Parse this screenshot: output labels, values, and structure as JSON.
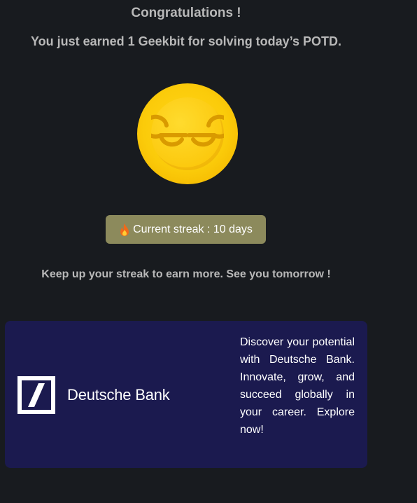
{
  "reward": {
    "title": "Congratulations !",
    "message": "You just earned 1 Geekbit for solving today’s POTD.",
    "coin_icon": "geekbit-coin-icon",
    "coin_color": "#fbcb0a"
  },
  "streak": {
    "icon": "flame-icon",
    "label": "Current streak : 10 days",
    "badge_color": "#8c8a5c"
  },
  "encouragement": "Keep up your streak to earn more. See you tomorrow !",
  "ad": {
    "brand_name": "Deutsche Bank",
    "logo_icon": "deutsche-bank-logo-icon",
    "text": "Discover your potential with Deutsche Bank. Innovate, grow, and succeed globally in your career. Explore now!",
    "background_color": "#1b1a4f"
  }
}
